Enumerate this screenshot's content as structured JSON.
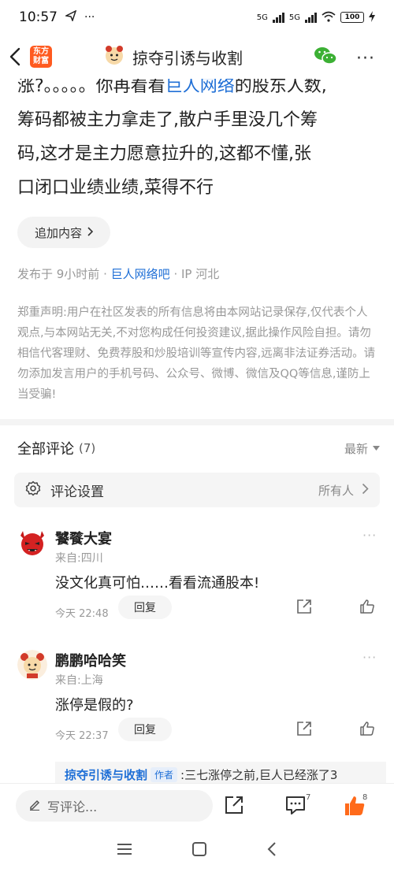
{
  "status_bar": {
    "time": "10:57",
    "net1": "5G",
    "net2": "5G",
    "battery": "100"
  },
  "nav": {
    "logo_line1": "东方",
    "logo_line2": "财富",
    "title": "掠夺引诱与收割"
  },
  "post": {
    "line1_a": "涨?。。。。。你再看看",
    "line1_link": "巨人网络",
    "line1_b": "的股东人数,",
    "line2": "筹码都被主力拿走了,散户手里没几个筹",
    "line3": "码,这才是主力愿意拉升的,这都不懂,张",
    "line4": "口闭口业绩业绩,菜得不行"
  },
  "add_content_label": "追加内容",
  "meta": {
    "posted": "发布于 9小时前 ·",
    "bar_name": "巨人网络吧",
    "ip": "· IP 河北"
  },
  "disclaimer": "郑重声明:用户在社区发表的所有信息将由本网站记录保存,仅代表个人观点,与本网站无关,不对您构成任何投资建议,据此操作风险自担。请勿相信代客理财、免费荐股和炒股培训等宣传内容,远离非法证券活动。请勿添加发言用户的手机号码、公众号、微博、微信及QQ等信息,谨防上当受骗!",
  "comments_header": {
    "title": "全部评论",
    "count": "(7)",
    "sort": "最新"
  },
  "comment_settings": {
    "label": "评论设置",
    "value": "所有人"
  },
  "comments": [
    {
      "name": "饕餮大宴",
      "location": "来自:四川",
      "text": "没文化真可怕……看看流通股本!",
      "time": "今天 22:48",
      "reply_label": "回复"
    },
    {
      "name": "鹏鹏哈哈笑",
      "location": "来自:上海",
      "text": "涨停是假的?",
      "time": "今天 22:37",
      "reply_label": "回复"
    }
  ],
  "author_reply": {
    "name": "掠夺引诱与收割",
    "badge": "作者",
    "text": ":三七涨停之前,巨人已经涨了3"
  },
  "bottom_bar": {
    "write_placeholder": "写评论...",
    "comment_count": "7",
    "like_count": "8",
    "like_color": "#ff6a1a"
  },
  "icons": [
    "back-icon",
    "wechat-icon",
    "more-icon",
    "gear-icon",
    "chevron-right-icon",
    "share-icon",
    "like-icon",
    "comment-icon",
    "pen-icon",
    "menu-icon",
    "home-icon",
    "back-nav-icon"
  ]
}
